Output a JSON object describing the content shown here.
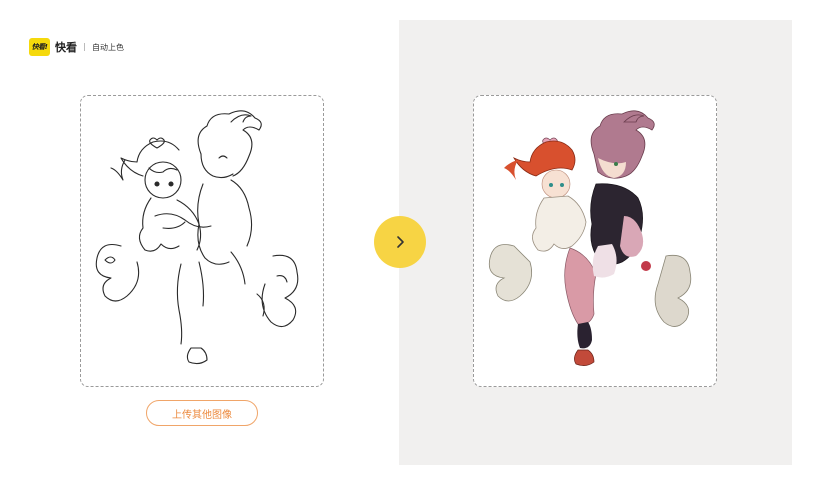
{
  "header": {
    "logo_text": "快看!",
    "brand": "快看",
    "section": "自动上色"
  },
  "upload_button": {
    "label": "上传其他图像"
  },
  "next_button": {
    "icon": "chevron-right-icon"
  },
  "images": {
    "input": "line-art-illustration",
    "output": "colorized-illustration"
  },
  "colors": {
    "accent_yellow": "#f7d444",
    "upload_orange": "#ec8a3e",
    "right_panel_bg": "#f1f0ef"
  }
}
